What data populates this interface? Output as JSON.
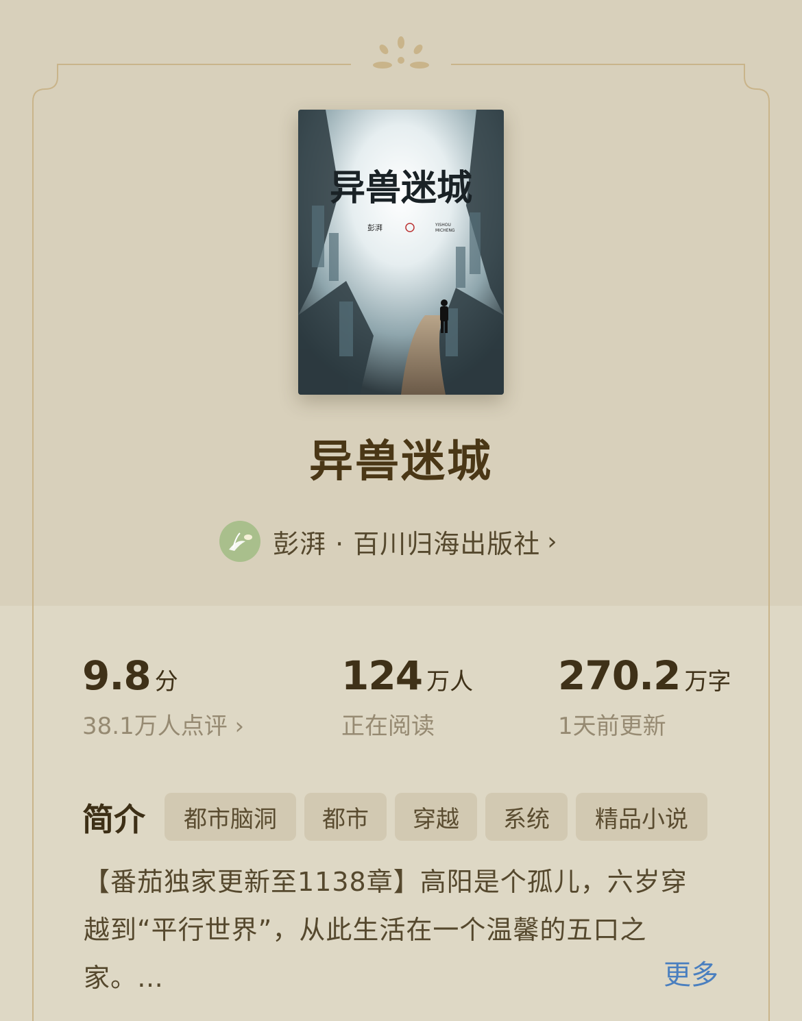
{
  "book": {
    "title": "异兽迷城",
    "cover": {
      "title": "异兽迷城",
      "author_small": "彭湃",
      "romanized_line1": "YISHOU",
      "romanized_line2": "MICHENG"
    }
  },
  "author_line": {
    "text": "彭湃 · 百川归海出版社",
    "chevron": "›"
  },
  "stats": [
    {
      "value": "9.8",
      "unit": "分",
      "sub": "38.1万人点评 ›"
    },
    {
      "value": "124",
      "unit": "万人",
      "sub": "正在阅读"
    },
    {
      "value": "270.2",
      "unit": "万字",
      "sub": "1天前更新"
    }
  ],
  "intro": {
    "label": "简介",
    "tags": [
      "都市脑洞",
      "都市",
      "穿越",
      "系统",
      "精品小说"
    ],
    "description_lines": [
      "【番茄独家更新至1138章】高阳是个孤儿，六岁穿",
      "越到“平行世界”，从此生活在一个温馨的五口之",
      "家。…"
    ],
    "more_label": "更多"
  },
  "colors": {
    "background_top": "#d8d0bb",
    "background_bottom": "#ded8c5",
    "title": "#4a3716",
    "link": "#4a7fbf",
    "frame_gold": "#c9b48a"
  }
}
